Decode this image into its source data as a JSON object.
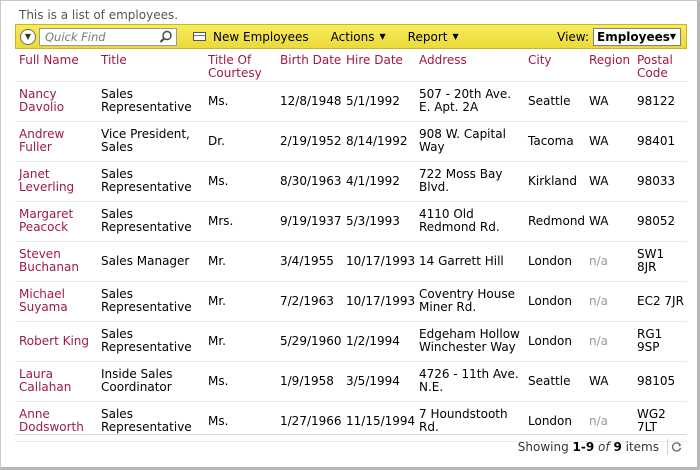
{
  "description": "This is a list of employees.",
  "toolbar": {
    "quick_find_placeholder": "Quick Find",
    "new_label": "New Employees",
    "actions_label": "Actions",
    "report_label": "Report",
    "view_label": "View:",
    "view_value": "Employees"
  },
  "columns": [
    "Full Name",
    "Title",
    "Title Of Courtesy",
    "Birth Date",
    "Hire Date",
    "Address",
    "City",
    "Region",
    "Postal Code"
  ],
  "rows": [
    [
      "Nancy Davolio",
      "Sales Representative",
      "Ms.",
      "12/8/1948",
      "5/1/1992",
      "507 - 20th Ave. E. Apt. 2A",
      "Seattle",
      "WA",
      "98122"
    ],
    [
      "Andrew Fuller",
      "Vice President, Sales",
      "Dr.",
      "2/19/1952",
      "8/14/1992",
      "908 W. Capital Way",
      "Tacoma",
      "WA",
      "98401"
    ],
    [
      "Janet Leverling",
      "Sales Representative",
      "Ms.",
      "8/30/1963",
      "4/1/1992",
      "722 Moss Bay Blvd.",
      "Kirkland",
      "WA",
      "98033"
    ],
    [
      "Margaret Peacock",
      "Sales Representative",
      "Mrs.",
      "9/19/1937",
      "5/3/1993",
      "4110 Old Redmond Rd.",
      "Redmond",
      "WA",
      "98052"
    ],
    [
      "Steven Buchanan",
      "Sales Manager",
      "Mr.",
      "3/4/1955",
      "10/17/1993",
      "14 Garrett Hill",
      "London",
      "n/a",
      "SW1 8JR"
    ],
    [
      "Michael Suyama",
      "Sales Representative",
      "Mr.",
      "7/2/1963",
      "10/17/1993",
      "Coventry House Miner Rd.",
      "London",
      "n/a",
      "EC2 7JR"
    ],
    [
      "Robert King",
      "Sales Representative",
      "Mr.",
      "5/29/1960",
      "1/2/1994",
      "Edgeham Hollow Winchester Way",
      "London",
      "n/a",
      "RG1 9SP"
    ],
    [
      "Laura Callahan",
      "Inside Sales Coordinator",
      "Ms.",
      "1/9/1958",
      "3/5/1994",
      "4726 - 11th Ave. N.E.",
      "Seattle",
      "WA",
      "98105"
    ],
    [
      "Anne Dodsworth",
      "Sales Representative",
      "Ms.",
      "1/27/1966",
      "11/15/1994",
      "7 Houndstooth Rd.",
      "London",
      "n/a",
      "WG2 7LT"
    ]
  ],
  "pager": {
    "showing": "Showing",
    "range": "1-9",
    "of": "of",
    "total": "9",
    "items": "items"
  },
  "colors": {
    "toolbar_bg": "#f2e24a",
    "link": "#9b1a4c",
    "muted": "#9a9a9a"
  },
  "icons": [
    "quick-find-toggle-icon",
    "search-icon",
    "new-record-icon",
    "refresh-icon"
  ]
}
